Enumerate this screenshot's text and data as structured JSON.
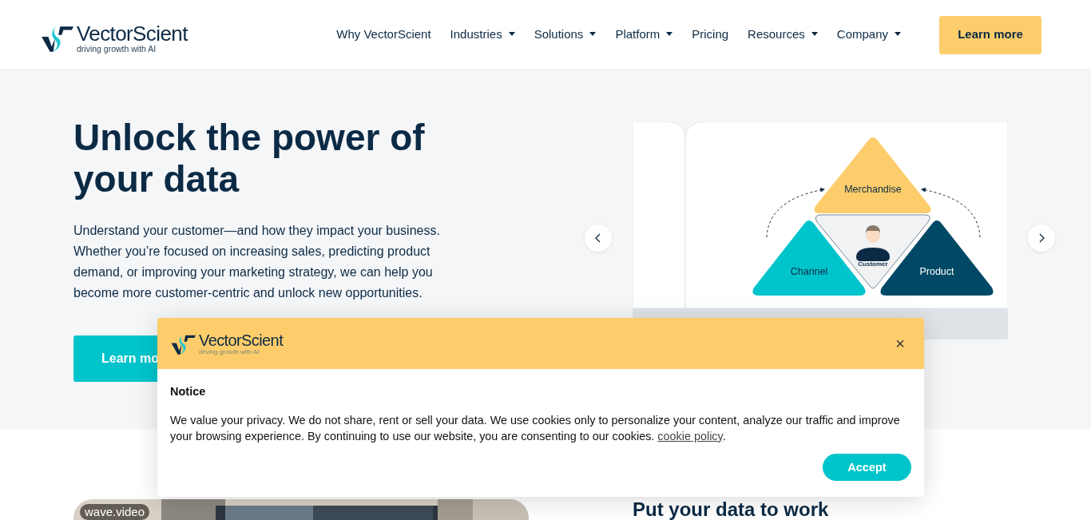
{
  "header": {
    "logo": {
      "name": "VectorScient",
      "tagline": "driving growth with AI"
    },
    "nav": [
      {
        "label": "Why VectorScient",
        "dropdown": false
      },
      {
        "label": "Industries",
        "dropdown": true
      },
      {
        "label": "Solutions",
        "dropdown": true
      },
      {
        "label": "Platform",
        "dropdown": true
      },
      {
        "label": "Pricing",
        "dropdown": false
      },
      {
        "label": "Resources",
        "dropdown": true
      },
      {
        "label": "Company",
        "dropdown": true
      }
    ],
    "cta": "Learn more"
  },
  "hero": {
    "title": "Unlock the power of your data",
    "text": "Understand your customer—and how they impact your business. Whether you’re focused on increasing sales, predicting product demand, or improving your marketing strategy, we can help you become more customer-centric and unlock new opportunities.",
    "button": "Learn mo",
    "carousel": {
      "top": "Merchandise",
      "left": "Channel",
      "right": "Product",
      "center": "Customer"
    }
  },
  "section": {
    "video_label": "wave.video",
    "heading": "Put your data to work"
  },
  "cookie_dialog": {
    "logo": {
      "name": "VectorScient",
      "tagline": "driving growth with AI"
    },
    "close": "×",
    "title": "Notice",
    "text": "We value your privacy. We do not share, rent or sell your data. We use cookies only to personalize your content, analyze our traffic and improve your browsing experience. By continuing to use our website, you are consenting to our cookies. ",
    "link": "cookie policy",
    "text_after": ".",
    "accept": "Accept"
  }
}
